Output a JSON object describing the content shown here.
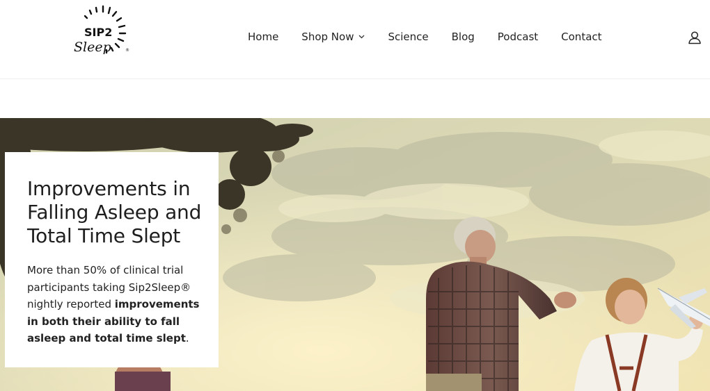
{
  "brand": {
    "logo_line1": "SIP2",
    "logo_line2": "Sleep",
    "logo_mark": "®"
  },
  "nav": {
    "items": [
      "Home",
      "Shop Now",
      "Science",
      "Blog",
      "Podcast",
      "Contact"
    ]
  },
  "icons": {
    "account": "user-icon",
    "dropdown": "chevron-down-icon"
  },
  "hero": {
    "title": "Improvements in Falling Asleep and Total Time Slept",
    "body": {
      "part1": "More than 50% of clinical trial participants taking Sip2Sleep® nightly reported ",
      "bold": "improvements in both their ability to fall asleep and total time slept",
      "part2": "."
    }
  },
  "colors": {
    "text": "#222222",
    "sky_light": "#e8e8c4",
    "sky_warm": "#f3e6b8",
    "foliage": "#3a3428"
  }
}
